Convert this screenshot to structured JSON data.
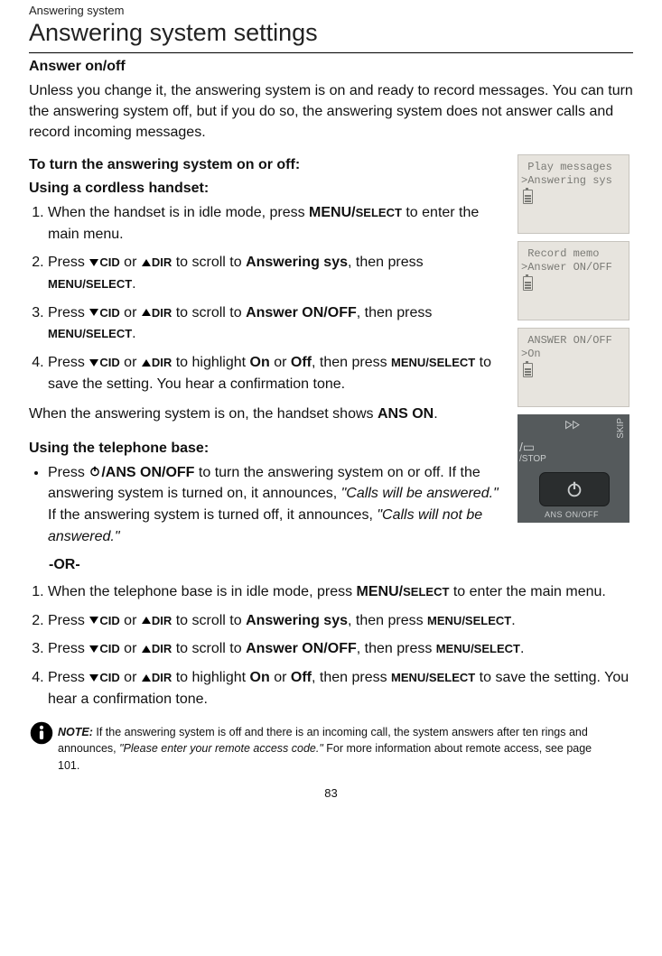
{
  "breadcrumb": "Answering system",
  "title": "Answering system settings",
  "section": "Answer on/off",
  "intro": "Unless you change it, the answering system is on and ready to record messages. You can turn the answering system off, but if you do so, the answering system does not answer calls and record incoming messages.",
  "handset": {
    "heading1": "To turn the answering system on or off:",
    "heading2": "Using a cordless handset:",
    "steps": {
      "s1a": "When the handset is in idle mode, press ",
      "s1b": "MENU/",
      "s1c": "SELECT",
      "s1d": " to enter the main menu.",
      "s2a": "Press ",
      "cid": "CID",
      "or": " or ",
      "dir": "DIR",
      "s2b": " to scroll to ",
      "s2target": "Answering sys",
      "s2c": ", then press ",
      "menuselect": "MENU/SELECT",
      "s2d": ".",
      "s3b": " to scroll to ",
      "s3target": "Answer ON/OFF",
      "s3c": ", then press ",
      "s3d": ".",
      "s4b": " to highlight ",
      "on": "On",
      "oror": " or ",
      "off": "Off",
      "s4c": ", then press ",
      "s4d": " to save the setting. You hear a confirmation tone."
    },
    "followup_a": "When the answering system is on, the handset shows ",
    "followup_b": "ANS ON",
    "followup_c": "."
  },
  "base": {
    "heading": "Using the telephone base:",
    "bullet_a": "Press ",
    "bullet_btn": "/ANS ON/OFF",
    "bullet_b": " to turn the answering system on or off. If the answering system is turned on, it announces, ",
    "bullet_q1": "\"Calls will be answered.\"",
    "bullet_c": " If the answering system is turned off, it announces, ",
    "bullet_q2": "\"Calls will not be answered.\"",
    "or_label": "-OR-",
    "steps": {
      "s1a": "When the telephone base is in idle mode, press ",
      "s1b": "MENU/",
      "s1c": "SELECT",
      "s1d": " to enter the main menu.",
      "s2b": " to scroll to ",
      "s2target": "Answering sys",
      "thenpress": ", then press ",
      "menuselect": "MENU/SELECT",
      "period": ".",
      "s3target": "Answer ON/OFF",
      "s4b": " to highlight ",
      "on": "On",
      "oror": " or ",
      "off": "Off",
      "s4c": ", then press ",
      "s4d": " to save the setting. You hear a confirmation tone."
    }
  },
  "lcd": {
    "box1_l1": " Play messages",
    "box1_l2": ">Answering sys",
    "box2_l1": " Record memo",
    "box2_l2": ">Answer ON/OFF",
    "box3_l1": " ANSWER ON/OFF",
    "box3_l2": ">On"
  },
  "photo": {
    "stop": "/STOP",
    "skip": "SKIP",
    "ansonoff": "ANS ON/OFF"
  },
  "note": {
    "label": "NOTE:",
    "a": " If the answering system is off and there is an incoming call, the system answers after ten rings and announces, ",
    "q": "\"Please enter your remote access code.\"",
    "b": " For more information about remote access, see page 101."
  },
  "page_number": "83"
}
